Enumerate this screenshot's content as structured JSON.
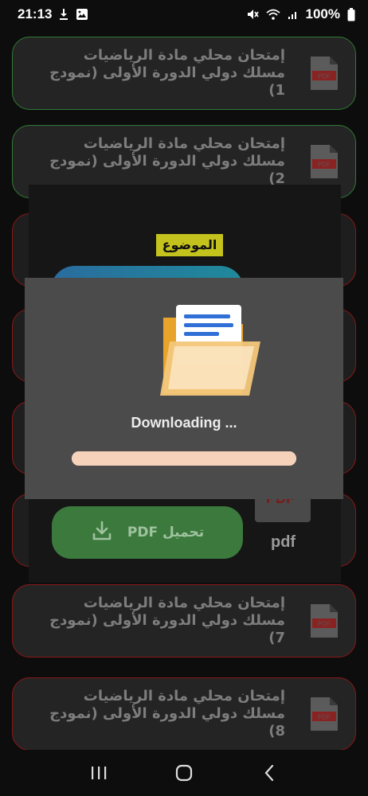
{
  "status_bar": {
    "time": "21:13",
    "battery": "100%",
    "icons": [
      "download-indicator-icon",
      "gallery-icon",
      "mute-icon",
      "wifi-icon",
      "signal-icon",
      "battery-icon"
    ]
  },
  "list": {
    "cards": [
      {
        "title": "إمتحان محلي مادة الرياضيات مسلك دولي الدورة الأولى (نمودج 1)",
        "icon": "pdf-icon"
      },
      {
        "title": "إمتحان محلي مادة الرياضيات مسلك دولي الدورة الأولى (نمودج 2)",
        "icon": "pdf-icon"
      },
      {
        "title": "إمتحان محلي مادة الرياضيات مسلك دولي الدورة الأولى (نمودج 7)",
        "icon": "pdf-icon"
      },
      {
        "title": "إمتحان محلي مادة الرياضيات مسلك دولي الدورة الأولى (نمودج 8)",
        "icon": "pdf-icon"
      }
    ]
  },
  "expanded": {
    "subject_label": "الموضوع",
    "download_button_label": "تحميل PDF",
    "pdf_badge": "PDF",
    "pdf_label": "pdf"
  },
  "dialog": {
    "title": "Downloading ...",
    "progress": 1.0,
    "colors": {
      "background": "#4c4b4c",
      "progress_track": "#fde7d9"
    }
  },
  "navbar": {
    "buttons": [
      "recent-apps-icon",
      "home-icon",
      "back-icon"
    ]
  }
}
